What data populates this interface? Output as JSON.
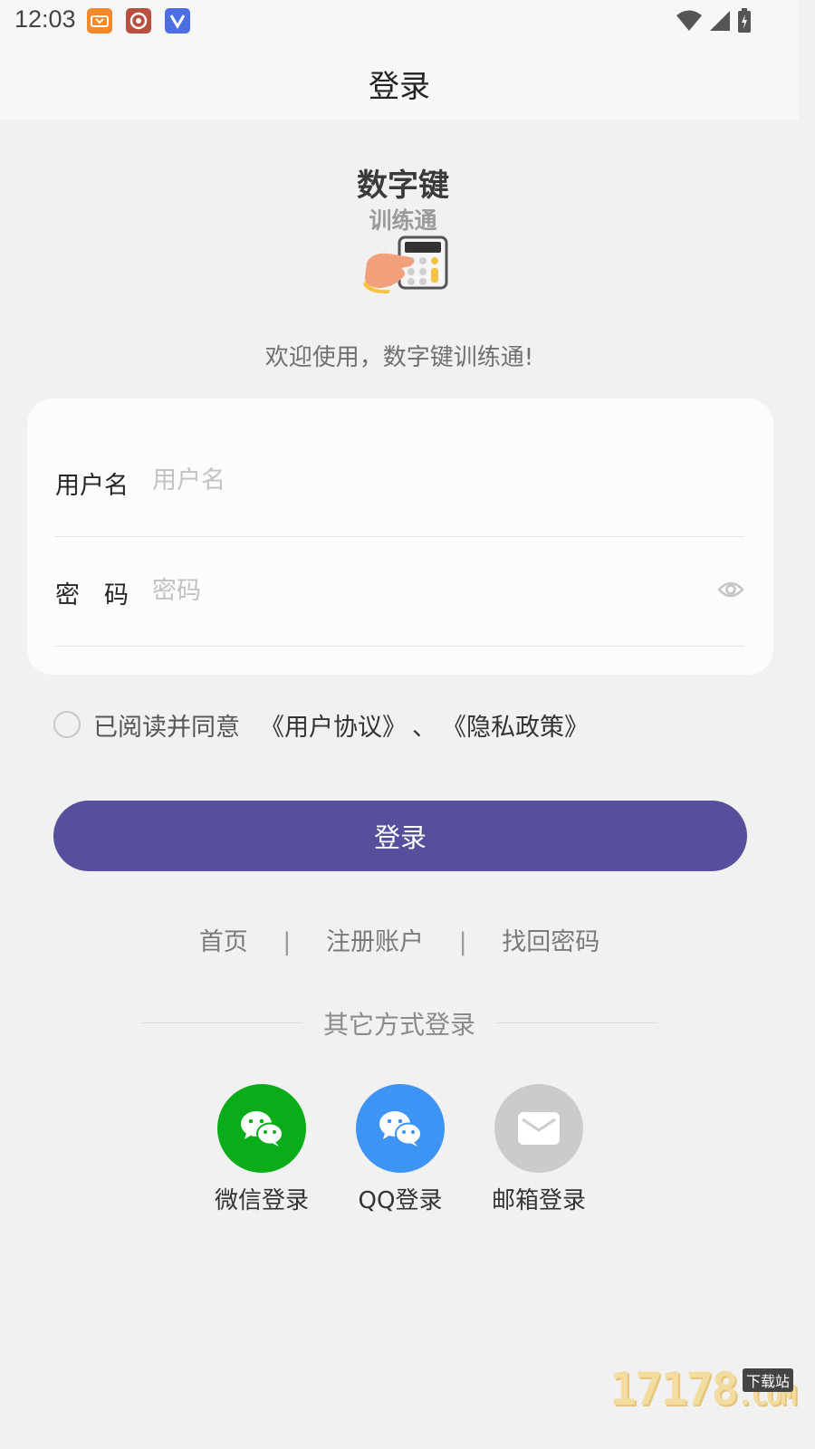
{
  "status_bar": {
    "time": "12:03"
  },
  "nav": {
    "title": "登录"
  },
  "logo": {
    "line1": "数字键",
    "line2": "训练通"
  },
  "welcome": "欢迎使用，数字键训练通!",
  "form": {
    "username_label": "用户名",
    "username_placeholder": "用户名",
    "username_value": "",
    "password_label": "密　码",
    "password_placeholder": "密码",
    "password_value": ""
  },
  "agreement": {
    "text": "已阅读并同意",
    "user_agreement": "《用户协议》",
    "separator": "、",
    "privacy_policy": "《隐私政策》",
    "checked": false
  },
  "login_button": "登录",
  "links": {
    "home": "首页",
    "register": "注册账户",
    "find_password": "找回密码",
    "divider": "|"
  },
  "other_login": {
    "title": "其它方式登录",
    "wechat": "微信登录",
    "qq": "QQ登录",
    "email": "邮箱登录"
  },
  "watermark": {
    "number": "17178",
    "tag": "下载站",
    "suffix": ".COM"
  },
  "colors": {
    "primary": "#564f9c",
    "wechat": "#0aad19",
    "qq": "#3e94f5",
    "email": "#cbcbcb",
    "background": "#f1f1f1"
  }
}
